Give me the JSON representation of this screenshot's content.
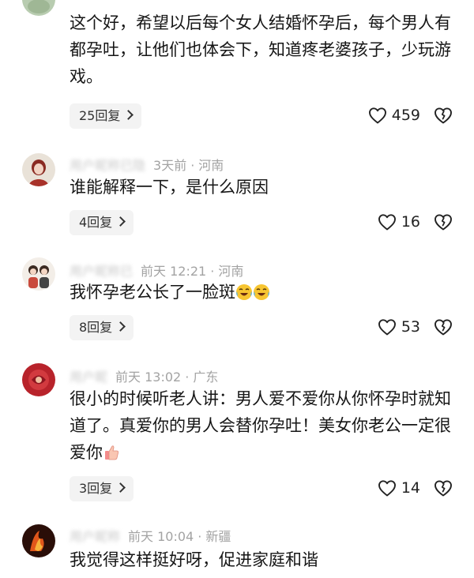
{
  "comments": [
    {
      "username": "",
      "time": "",
      "location": "",
      "text": "这个好，希望以后每个女人结婚怀孕后，每个男人有都孕吐，让他们也体会下，知道疼老婆孩子，少玩游戏。",
      "replies_label": "25回复",
      "likes": "459"
    },
    {
      "username": "",
      "time": "3天前",
      "location": "河南",
      "text": "谁能解释一下，是什么原因",
      "replies_label": "4回复",
      "likes": "16"
    },
    {
      "username": "",
      "time": "前天 12:21",
      "location": "河南",
      "text": "我怀孕老公长了一脸斑",
      "replies_label": "8回复",
      "likes": "53"
    },
    {
      "username": "",
      "time": "前天 13:02",
      "location": "广东",
      "text": "很小的时候听老人讲：男人爱不爱你从你怀孕时就知道了。真爱你的男人会替你孕吐！美女你老公一定很爱你",
      "replies_label": "3回复",
      "likes": "14"
    },
    {
      "username": "",
      "time": "前天 10:04",
      "location": "新疆",
      "text": "我觉得这样挺好呀，促进家庭和谐"
    }
  ],
  "icons": {
    "like": "heart-outline-icon",
    "dislike": "broken-heart-outline-icon",
    "replies": "chevron-right-icon",
    "emoji_laugh": "laughing-crying-emoji",
    "emoji_thumb": "thumbs-up-emoji"
  },
  "colors": {
    "meta_text": "#a3a3a3",
    "body_text": "#161616",
    "reply_pill_bg": "#f3f3f3"
  }
}
